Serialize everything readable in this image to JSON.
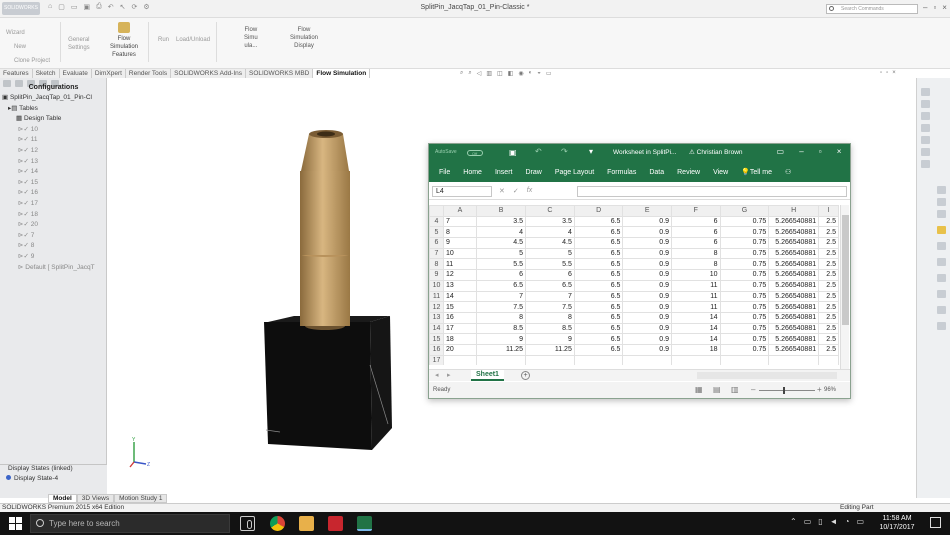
{
  "window": {
    "app_badge": "SOLIDWORKS",
    "title": "SplitPin_JacqTap_01_Pin-Classic *",
    "search_placeholder": "Search Commands"
  },
  "ribbon": {
    "wizard": "Wizard",
    "new": "New",
    "clone_project": "Clone Project",
    "general_settings": [
      "General",
      "Settings"
    ],
    "flow_sim_features": [
      "Flow",
      "Simulation",
      "Features"
    ],
    "run": "Run",
    "load_unload": "Load/Unload",
    "flow_sim_small": [
      "Flow",
      "Simu",
      "ula..."
    ],
    "flow_sim_display": [
      "Flow",
      "Simulation",
      "Display"
    ]
  },
  "command_tabs": [
    "Features",
    "Sketch",
    "Evaluate",
    "DimXpert",
    "Render Tools",
    "SOLIDWORKS Add-Ins",
    "SOLIDWORKS MBD",
    "Flow Simulation"
  ],
  "active_command_tab": "Flow Simulation",
  "config_manager": {
    "header": "Configurations",
    "root": "SplitPin_JacqTap_01_Pin-Cl",
    "tables": "Tables",
    "design_table": "Design Table",
    "configs": [
      "10",
      "11",
      "12",
      "13",
      "14",
      "15",
      "16",
      "17",
      "18",
      "20",
      "7",
      "8",
      "9"
    ],
    "default": "Default [ SplitPin_JacqT"
  },
  "display_states": {
    "header": "Display States (linked)",
    "item": "Display State-4"
  },
  "bottom_tabs": [
    "Model",
    "3D Views",
    "Motion Study 1"
  ],
  "status": {
    "left": "SOLIDWORKS Premium 2015 x64 Edition",
    "right": "Editing Part"
  },
  "excel": {
    "autosave": "AutoSave",
    "autosave_state": "Off",
    "doc_title": "Worksheet in SplitPi...",
    "user": "Christian Brown",
    "ribbon_tabs": [
      "File",
      "Home",
      "Insert",
      "Draw",
      "Page Layout",
      "Formulas",
      "Data",
      "Review",
      "View",
      "Tell me"
    ],
    "name_box": "L4",
    "column_headers": [
      "A",
      "B",
      "C",
      "D",
      "E",
      "F",
      "G",
      "H",
      "I"
    ],
    "rows": [
      {
        "n": "4",
        "cells": [
          "7",
          "3.5",
          "3.5",
          "6.5",
          "0.9",
          "6",
          "0.75",
          "5.266540881",
          "2.5"
        ]
      },
      {
        "n": "5",
        "cells": [
          "8",
          "4",
          "4",
          "6.5",
          "0.9",
          "6",
          "0.75",
          "5.266540881",
          "2.5"
        ]
      },
      {
        "n": "6",
        "cells": [
          "9",
          "4.5",
          "4.5",
          "6.5",
          "0.9",
          "6",
          "0.75",
          "5.266540881",
          "2.5"
        ]
      },
      {
        "n": "7",
        "cells": [
          "10",
          "5",
          "5",
          "6.5",
          "0.9",
          "8",
          "0.75",
          "5.266540881",
          "2.5"
        ]
      },
      {
        "n": "8",
        "cells": [
          "11",
          "5.5",
          "5.5",
          "6.5",
          "0.9",
          "8",
          "0.75",
          "5.266540881",
          "2.5"
        ]
      },
      {
        "n": "9",
        "cells": [
          "12",
          "6",
          "6",
          "6.5",
          "0.9",
          "10",
          "0.75",
          "5.266540881",
          "2.5"
        ]
      },
      {
        "n": "10",
        "cells": [
          "13",
          "6.5",
          "6.5",
          "6.5",
          "0.9",
          "11",
          "0.75",
          "5.266540881",
          "2.5"
        ]
      },
      {
        "n": "11",
        "cells": [
          "14",
          "7",
          "7",
          "6.5",
          "0.9",
          "11",
          "0.75",
          "5.266540881",
          "2.5"
        ]
      },
      {
        "n": "12",
        "cells": [
          "15",
          "7.5",
          "7.5",
          "6.5",
          "0.9",
          "11",
          "0.75",
          "5.266540881",
          "2.5"
        ]
      },
      {
        "n": "13",
        "cells": [
          "16",
          "8",
          "8",
          "6.5",
          "0.9",
          "14",
          "0.75",
          "5.266540881",
          "2.5"
        ]
      },
      {
        "n": "14",
        "cells": [
          "17",
          "8.5",
          "8.5",
          "6.5",
          "0.9",
          "14",
          "0.75",
          "5.266540881",
          "2.5"
        ]
      },
      {
        "n": "15",
        "cells": [
          "18",
          "9",
          "9",
          "6.5",
          "0.9",
          "14",
          "0.75",
          "5.266540881",
          "2.5"
        ]
      },
      {
        "n": "16",
        "cells": [
          "20",
          "11.25",
          "11.25",
          "6.5",
          "0.9",
          "18",
          "0.75",
          "5.266540881",
          "2.5"
        ]
      },
      {
        "n": "17",
        "cells": [
          "",
          "",
          "",
          "",
          "",
          "",
          "",
          "",
          ""
        ]
      }
    ],
    "sheet_tab": "Sheet1",
    "status": "Ready",
    "zoom": "96%"
  },
  "taskbar": {
    "search_placeholder": "Type here to search",
    "time": "11:58 AM",
    "date": "10/17/2017"
  },
  "colors": {
    "excel_green": "#217346",
    "pin_brass": "#c9a36b",
    "block_black": "#0d0d0d",
    "taskbar": "#121212"
  }
}
